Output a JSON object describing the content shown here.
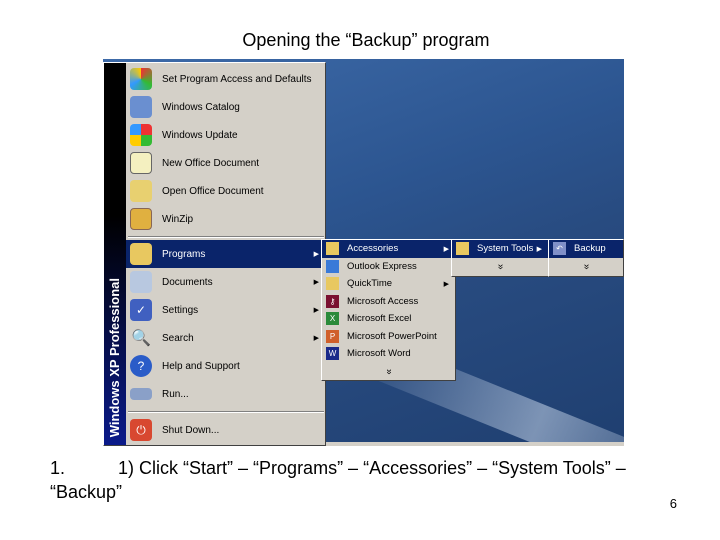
{
  "title": "Opening the “Backup” program",
  "start_menu": {
    "band": "Windows XP Professional",
    "top_items": [
      {
        "label": "Set Program Access and Defaults",
        "icon": "program-access-icon"
      },
      {
        "label": "Windows Catalog",
        "icon": "windows-catalog-icon"
      },
      {
        "label": "Windows Update",
        "icon": "windows-update-icon"
      },
      {
        "label": "New Office Document",
        "icon": "new-office-document-icon"
      },
      {
        "label": "Open Office Document",
        "icon": "open-office-document-icon"
      },
      {
        "label": "WinZip",
        "icon": "winzip-icon"
      }
    ],
    "items": [
      {
        "label": "Programs"
      },
      {
        "label": "Documents"
      },
      {
        "label": "Settings"
      },
      {
        "label": "Search"
      },
      {
        "label": "Help and Support"
      },
      {
        "label": "Run..."
      }
    ],
    "shutdown": "Shut Down..."
  },
  "programs_menu": [
    "Accessories",
    "Outlook Express",
    "QuickTime",
    "Microsoft Access",
    "Microsoft Excel",
    "Microsoft PowerPoint",
    "Microsoft Word"
  ],
  "accessories_menu": [
    "System Tools"
  ],
  "system_tools_menu": [
    "Backup"
  ],
  "expand_chevron": "»",
  "caption_number": "1.",
  "caption": "1) Click “Start” – “Programs” – “Accessories” – “System Tools” – “Backup”",
  "page_number": "6",
  "colors": {
    "highlight": "#0a246a",
    "menu": "#d4d0c8"
  }
}
